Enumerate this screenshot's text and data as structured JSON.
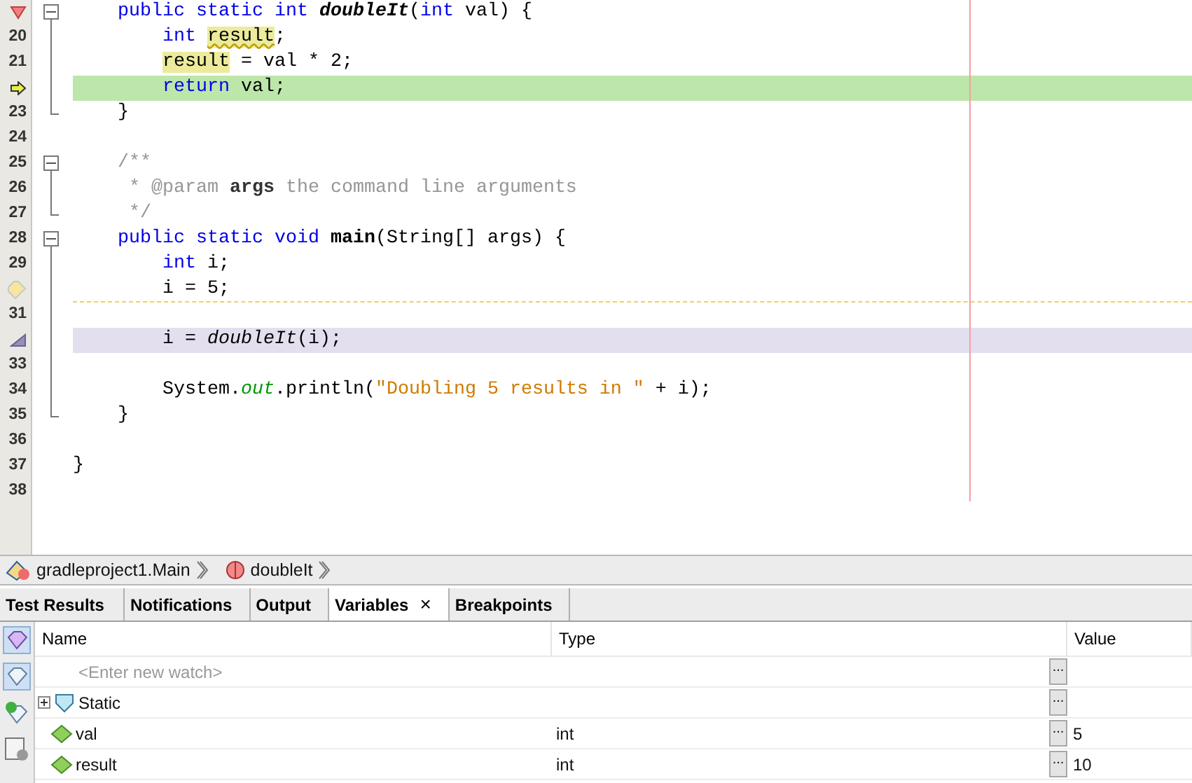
{
  "editor": {
    "lines": [
      {
        "marker": {
          "kind": "breakpoint"
        },
        "fold": {
          "kind": "start"
        },
        "tokens": [
          {
            "text": "    public static int",
            "kind": "keyword"
          },
          {
            "text": " doubleIt",
            "kind": "decl"
          },
          {
            "text": "("
          },
          {
            "text": "int",
            "kind": "keyword"
          },
          {
            "text": " val) {"
          }
        ]
      },
      {
        "number": "20",
        "fold": {
          "kind": "line"
        },
        "tokens": [
          {
            "text": "        int",
            "kind": "keyword"
          },
          {
            "text": " result",
            "kind": "mark-warning"
          },
          {
            "text": ";"
          }
        ]
      },
      {
        "number": "21",
        "fold": {
          "kind": "line"
        },
        "tokens": [
          {
            "text": "        result",
            "kind": "mark"
          },
          {
            "text": " = val * 2;"
          }
        ]
      },
      {
        "marker": {
          "kind": "current"
        },
        "fold": {
          "kind": "line"
        },
        "highlight": {
          "kind": "current"
        },
        "tokens": [
          {
            "text": "        return",
            "kind": "keyword"
          },
          {
            "text": " val;"
          }
        ]
      },
      {
        "number": "23",
        "fold": {
          "kind": "end"
        },
        "tokens": [
          {
            "text": "    }"
          }
        ]
      },
      {
        "number": "24"
      },
      {
        "number": "25",
        "fold": {
          "kind": "start"
        },
        "tokens": [
          {
            "text": "    /**",
            "kind": "comment"
          }
        ]
      },
      {
        "number": "26",
        "fold": {
          "kind": "line"
        },
        "tokens": [
          {
            "text": "     * @param",
            "kind": "comment"
          },
          {
            "text": " args",
            "kind": "comment-name"
          },
          {
            "text": " the command line arguments",
            "kind": "comment"
          }
        ]
      },
      {
        "number": "27",
        "fold": {
          "kind": "end"
        },
        "tokens": [
          {
            "text": "     */",
            "kind": "comment"
          }
        ]
      },
      {
        "number": "28",
        "fold": {
          "kind": "start"
        },
        "tokens": [
          {
            "text": "    public static void",
            "kind": "keyword"
          },
          {
            "text": " main",
            "kind": "bold"
          },
          {
            "text": "(String[] args) {"
          }
        ]
      },
      {
        "number": "29",
        "fold": {
          "kind": "line"
        },
        "tokens": [
          {
            "text": "        int",
            "kind": "keyword"
          },
          {
            "text": " i;"
          }
        ]
      },
      {
        "marker": {
          "kind": "hint"
        },
        "fold": {
          "kind": "line"
        },
        "highlight": {
          "kind": "hint"
        },
        "tokens": [
          {
            "text": "        i = 5;"
          }
        ]
      },
      {
        "number": "31",
        "fold": {
          "kind": "line"
        }
      },
      {
        "marker": {
          "kind": "call"
        },
        "fold": {
          "kind": "line"
        },
        "highlight": {
          "kind": "call"
        },
        "tokens": [
          {
            "text": "        i = "
          },
          {
            "text": "doubleIt",
            "kind": "italic"
          },
          {
            "text": "(i);"
          }
        ]
      },
      {
        "number": "33",
        "fold": {
          "kind": "line"
        }
      },
      {
        "number": "34",
        "fold": {
          "kind": "line"
        },
        "tokens": [
          {
            "text": "        System."
          },
          {
            "text": "out",
            "kind": "field"
          },
          {
            "text": ".println("
          },
          {
            "text": "\"Doubling 5 results in \"",
            "kind": "string"
          },
          {
            "text": " + i);"
          }
        ]
      },
      {
        "number": "35",
        "fold": {
          "kind": "end"
        },
        "tokens": [
          {
            "text": "    }"
          }
        ]
      },
      {
        "number": "36"
      },
      {
        "number": "37",
        "tokens": [
          {
            "text": "}"
          }
        ]
      },
      {
        "number": "38"
      }
    ]
  },
  "breadcrumbs": [
    {
      "label": "gradleproject1.Main",
      "kind": "class"
    },
    {
      "label": "doubleIt",
      "kind": "method"
    }
  ],
  "tabs": [
    {
      "label": "Test Results",
      "selected": false
    },
    {
      "label": "Notifications",
      "selected": false
    },
    {
      "label": "Output",
      "selected": false
    },
    {
      "label": "Variables",
      "selected": true,
      "close": "×"
    },
    {
      "label": "Breakpoints",
      "selected": false
    }
  ],
  "table": {
    "columns": [
      "Name",
      "Type",
      "Value"
    ],
    "rows": [
      {
        "kind": "watch",
        "placeholder": "<Enter new watch>"
      },
      {
        "kind": "group",
        "name": "Static",
        "expanded": false
      },
      {
        "kind": "variable",
        "name": "val",
        "type": "int",
        "value": "5"
      },
      {
        "kind": "variable",
        "name": "result",
        "type": "int",
        "value": "10"
      }
    ],
    "more": "..."
  }
}
